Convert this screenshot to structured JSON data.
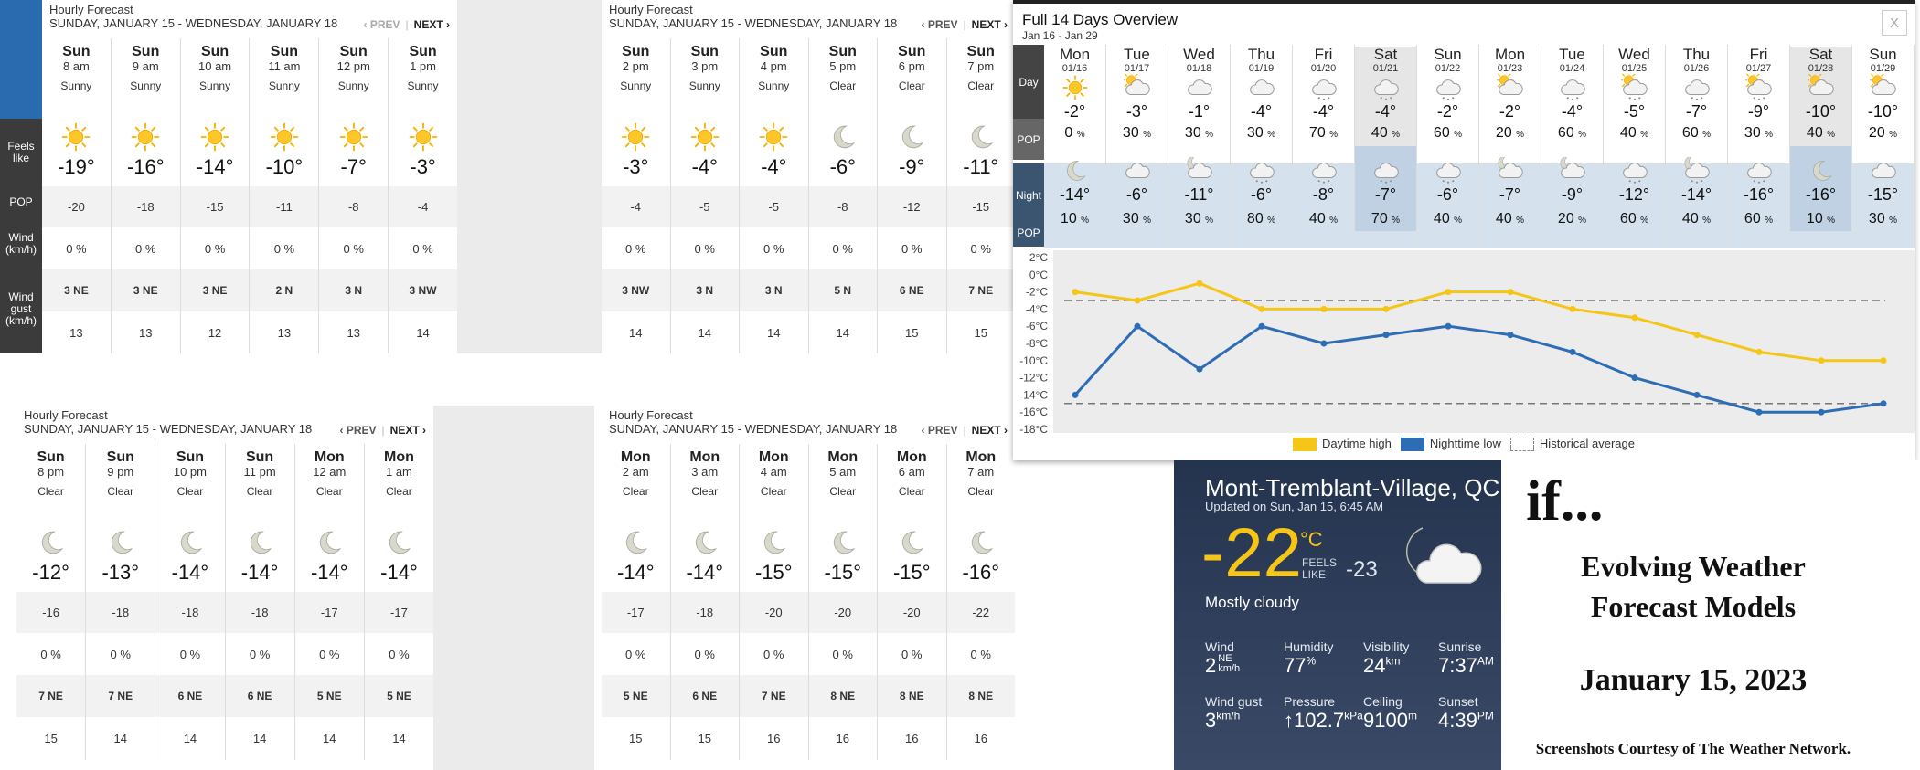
{
  "hourly_panels": [
    {
      "title": "Hourly Forecast",
      "range": "SUNDAY, JANUARY 15 - WEDNESDAY, JANUARY 18",
      "prev": "‹ PREV",
      "next": "NEXT ›",
      "hours": [
        {
          "day": "Sun",
          "hour": "8 am",
          "cond": "Sunny",
          "icon": "sun-icon",
          "temp": "-19°",
          "feels": "-20",
          "pop": "0 %",
          "wind": "3 NE",
          "gust": "13"
        },
        {
          "day": "Sun",
          "hour": "9 am",
          "cond": "Sunny",
          "icon": "sun-icon",
          "temp": "-16°",
          "feels": "-18",
          "pop": "0 %",
          "wind": "3 NE",
          "gust": "13"
        },
        {
          "day": "Sun",
          "hour": "10 am",
          "cond": "Sunny",
          "icon": "sun-icon",
          "temp": "-14°",
          "feels": "-15",
          "pop": "0 %",
          "wind": "3 NE",
          "gust": "12"
        },
        {
          "day": "Sun",
          "hour": "11 am",
          "cond": "Sunny",
          "icon": "sun-icon",
          "temp": "-10°",
          "feels": "-11",
          "pop": "0 %",
          "wind": "2 N",
          "gust": "13"
        },
        {
          "day": "Sun",
          "hour": "12 pm",
          "cond": "Sunny",
          "icon": "sun-icon",
          "temp": "-7°",
          "feels": "-8",
          "pop": "0 %",
          "wind": "3 N",
          "gust": "13"
        },
        {
          "day": "Sun",
          "hour": "1 pm",
          "cond": "Sunny",
          "icon": "sun-icon",
          "temp": "-3°",
          "feels": "-4",
          "pop": "0 %",
          "wind": "3 NW",
          "gust": "14"
        }
      ]
    },
    {
      "title": "Hourly Forecast",
      "range": "SUNDAY, JANUARY 15 - WEDNESDAY, JANUARY 18",
      "prev": "‹ PREV",
      "next": "NEXT ›",
      "hours": [
        {
          "day": "Sun",
          "hour": "2 pm",
          "cond": "Sunny",
          "icon": "sun-icon",
          "temp": "-3°",
          "feels": "-4",
          "pop": "0 %",
          "wind": "3 NW",
          "gust": "14"
        },
        {
          "day": "Sun",
          "hour": "3 pm",
          "cond": "Sunny",
          "icon": "sun-icon",
          "temp": "-4°",
          "feels": "-5",
          "pop": "0 %",
          "wind": "3 N",
          "gust": "14"
        },
        {
          "day": "Sun",
          "hour": "4 pm",
          "cond": "Sunny",
          "icon": "sun-icon",
          "temp": "-4°",
          "feels": "-5",
          "pop": "0 %",
          "wind": "3 N",
          "gust": "14"
        },
        {
          "day": "Sun",
          "hour": "5 pm",
          "cond": "Clear",
          "icon": "moon-icon",
          "temp": "-6°",
          "feels": "-8",
          "pop": "0 %",
          "wind": "5 N",
          "gust": "14"
        },
        {
          "day": "Sun",
          "hour": "6 pm",
          "cond": "Clear",
          "icon": "moon-icon",
          "temp": "-9°",
          "feels": "-12",
          "pop": "0 %",
          "wind": "6 NE",
          "gust": "15"
        },
        {
          "day": "Sun",
          "hour": "7 pm",
          "cond": "Clear",
          "icon": "moon-icon",
          "temp": "-11°",
          "feels": "-15",
          "pop": "0 %",
          "wind": "7 NE",
          "gust": "15"
        }
      ]
    },
    {
      "title": "Hourly Forecast",
      "range": "SUNDAY, JANUARY 15 - WEDNESDAY, JANUARY 18",
      "prev": "‹ PREV",
      "next": "NEXT ›",
      "hours": [
        {
          "day": "Sun",
          "hour": "8 pm",
          "cond": "Clear",
          "icon": "moon-icon",
          "temp": "-12°",
          "feels": "-16",
          "pop": "0 %",
          "wind": "7 NE",
          "gust": "15"
        },
        {
          "day": "Sun",
          "hour": "9 pm",
          "cond": "Clear",
          "icon": "moon-icon",
          "temp": "-13°",
          "feels": "-18",
          "pop": "0 %",
          "wind": "7 NE",
          "gust": "14"
        },
        {
          "day": "Sun",
          "hour": "10 pm",
          "cond": "Clear",
          "icon": "moon-icon",
          "temp": "-14°",
          "feels": "-18",
          "pop": "0 %",
          "wind": "6 NE",
          "gust": "14"
        },
        {
          "day": "Sun",
          "hour": "11 pm",
          "cond": "Clear",
          "icon": "moon-icon",
          "temp": "-14°",
          "feels": "-18",
          "pop": "0 %",
          "wind": "6 NE",
          "gust": "14"
        },
        {
          "day": "Mon",
          "hour": "12 am",
          "cond": "Clear",
          "icon": "moon-icon",
          "temp": "-14°",
          "feels": "-17",
          "pop": "0 %",
          "wind": "5 NE",
          "gust": "14"
        },
        {
          "day": "Mon",
          "hour": "1 am",
          "cond": "Clear",
          "icon": "moon-icon",
          "temp": "-14°",
          "feels": "-17",
          "pop": "0 %",
          "wind": "5 NE",
          "gust": "14"
        }
      ]
    },
    {
      "title": "Hourly Forecast",
      "range": "SUNDAY, JANUARY 15 - WEDNESDAY, JANUARY 18",
      "prev": "‹ PREV",
      "next": "NEXT ›",
      "hours": [
        {
          "day": "Mon",
          "hour": "2 am",
          "cond": "Clear",
          "icon": "moon-icon",
          "temp": "-14°",
          "feels": "-17",
          "pop": "0 %",
          "wind": "5 NE",
          "gust": "15"
        },
        {
          "day": "Mon",
          "hour": "3 am",
          "cond": "Clear",
          "icon": "moon-icon",
          "temp": "-14°",
          "feels": "-18",
          "pop": "0 %",
          "wind": "6 NE",
          "gust": "15"
        },
        {
          "day": "Mon",
          "hour": "4 am",
          "cond": "Clear",
          "icon": "moon-icon",
          "temp": "-15°",
          "feels": "-20",
          "pop": "0 %",
          "wind": "7 NE",
          "gust": "16"
        },
        {
          "day": "Mon",
          "hour": "5 am",
          "cond": "Clear",
          "icon": "moon-icon",
          "temp": "-15°",
          "feels": "-20",
          "pop": "0 %",
          "wind": "8 NE",
          "gust": "16"
        },
        {
          "day": "Mon",
          "hour": "6 am",
          "cond": "Clear",
          "icon": "moon-icon",
          "temp": "-15°",
          "feels": "-20",
          "pop": "0 %",
          "wind": "8 NE",
          "gust": "16"
        },
        {
          "day": "Mon",
          "hour": "7 am",
          "cond": "Clear",
          "icon": "moon-icon",
          "temp": "-16°",
          "feels": "-22",
          "pop": "0 %",
          "wind": "8 NE",
          "gust": "16"
        }
      ]
    }
  ],
  "row_labels": {
    "feels": "Feels like",
    "pop": "POP",
    "wind": "Wind (km/h)",
    "gust": "Wind gust (km/h)"
  },
  "overview": {
    "title": "Full 14 Days Overview",
    "range": "Jan 16 - Jan 29",
    "close": "X",
    "labels": {
      "day": "Day",
      "pop": "POP",
      "night": "Night",
      "pop2": "POP"
    },
    "days": [
      {
        "dow": "Mon",
        "date": "01/16",
        "day_icon": "sun-icon",
        "high": "-2°",
        "day_pop": "0",
        "night_icon": "moon-icon",
        "low": "-14°",
        "night_pop": "10"
      },
      {
        "dow": "Tue",
        "date": "01/17",
        "day_icon": "sun-cloud-icon",
        "high": "-3°",
        "day_pop": "30",
        "night_icon": "cloud-icon",
        "low": "-6°",
        "night_pop": "30"
      },
      {
        "dow": "Wed",
        "date": "01/18",
        "day_icon": "cloud-icon",
        "high": "-1°",
        "day_pop": "30",
        "night_icon": "moon-cloud-icon",
        "low": "-11°",
        "night_pop": "30"
      },
      {
        "dow": "Thu",
        "date": "01/19",
        "day_icon": "cloud-icon",
        "high": "-4°",
        "day_pop": "30",
        "night_icon": "snow-cloud-icon",
        "low": "-6°",
        "night_pop": "80"
      },
      {
        "dow": "Fri",
        "date": "01/20",
        "day_icon": "snow-cloud-icon",
        "high": "-4°",
        "day_pop": "70",
        "night_icon": "snow-cloud-icon",
        "low": "-8°",
        "night_pop": "40"
      },
      {
        "dow": "Sat",
        "date": "01/21",
        "day_icon": "snow-cloud-icon",
        "high": "-4°",
        "day_pop": "40",
        "night_icon": "snow-cloud-icon",
        "low": "-7°",
        "night_pop": "70"
      },
      {
        "dow": "Sun",
        "date": "01/22",
        "day_icon": "snow-cloud-icon",
        "high": "-2°",
        "day_pop": "60",
        "night_icon": "snow-cloud-icon",
        "low": "-6°",
        "night_pop": "40"
      },
      {
        "dow": "Mon",
        "date": "01/23",
        "day_icon": "sun-cloud-icon",
        "high": "-2°",
        "day_pop": "20",
        "night_icon": "moon-cloud-icon",
        "low": "-7°",
        "night_pop": "40"
      },
      {
        "dow": "Tue",
        "date": "01/24",
        "day_icon": "snow-cloud-icon",
        "high": "-4°",
        "day_pop": "60",
        "night_icon": "moon-cloud-icon",
        "low": "-9°",
        "night_pop": "20"
      },
      {
        "dow": "Wed",
        "date": "01/25",
        "day_icon": "sun-snow-icon",
        "high": "-5°",
        "day_pop": "40",
        "night_icon": "snow-cloud-icon",
        "low": "-12°",
        "night_pop": "60"
      },
      {
        "dow": "Thu",
        "date": "01/26",
        "day_icon": "snow-cloud-icon",
        "high": "-7°",
        "day_pop": "60",
        "night_icon": "moon-snow-icon",
        "low": "-14°",
        "night_pop": "40"
      },
      {
        "dow": "Fri",
        "date": "01/27",
        "day_icon": "sun-snow-icon",
        "high": "-9°",
        "day_pop": "30",
        "night_icon": "snow-cloud-icon",
        "low": "-16°",
        "night_pop": "60"
      },
      {
        "dow": "Sat",
        "date": "01/28",
        "day_icon": "sun-cloud-icon",
        "high": "-10°",
        "day_pop": "40",
        "night_icon": "moon-icon",
        "low": "-16°",
        "night_pop": "10"
      },
      {
        "dow": "Sun",
        "date": "01/29",
        "day_icon": "sun-cloud-icon",
        "high": "-10°",
        "day_pop": "20",
        "night_icon": "cloud-icon",
        "low": "-15°",
        "night_pop": "30"
      }
    ],
    "pop_unit": "%"
  },
  "chart_data": {
    "type": "line",
    "categories": [
      "01/16",
      "01/17",
      "01/18",
      "01/19",
      "01/20",
      "01/21",
      "01/22",
      "01/23",
      "01/24",
      "01/25",
      "01/26",
      "01/27",
      "01/28",
      "01/29"
    ],
    "series": [
      {
        "name": "Daytime high",
        "color": "#f5c518",
        "values": [
          -2,
          -3,
          -1,
          -4,
          -4,
          -4,
          -2,
          -2,
          -4,
          -5,
          -7,
          -9,
          -10,
          -10
        ]
      },
      {
        "name": "Nighttime low",
        "color": "#2d6db5",
        "values": [
          -14,
          -6,
          -11,
          -6,
          -8,
          -7,
          -6,
          -7,
          -9,
          -12,
          -14,
          -16,
          -16,
          -15
        ]
      }
    ],
    "historical_average": {
      "name": "Historical average",
      "high": -3,
      "low": -15
    },
    "yticks": [
      "2°C",
      "0°C",
      "-2°C",
      "-4°C",
      "-6°C",
      "-8°C",
      "-10°C",
      "-12°C",
      "-14°C",
      "-16°C",
      "-18°C"
    ],
    "ylim": [
      -18,
      2
    ],
    "legend_position": "bottom"
  },
  "current": {
    "city": "Mont-Tremblant-Village, QC",
    "updated": "Updated on Sun, Jan 15, 6:45 AM",
    "temp": "-22",
    "unit": "°C",
    "feels_label_1": "FEELS",
    "feels_label_2": "LIKE",
    "feels_value": "-23",
    "condition": "Mostly cloudy",
    "icon": "moon-cloud-icon",
    "stats": {
      "wind_label": "Wind",
      "wind_value": "2",
      "wind_dir": "NE",
      "wind_unit": "km/h",
      "humidity_label": "Humidity",
      "humidity_value": "77",
      "humidity_unit": "%",
      "visibility_label": "Visibility",
      "visibility_value": "24",
      "visibility_unit": "km",
      "sunrise_label": "Sunrise",
      "sunrise_value": "7:37",
      "sunrise_unit": "AM",
      "gust_label": "Wind gust",
      "gust_value": "3",
      "gust_unit": "km/h",
      "pressure_label": "Pressure",
      "pressure_value": "↑102.7",
      "pressure_unit": "kPa",
      "ceiling_label": "Ceiling",
      "ceiling_value": "9100",
      "ceiling_unit": "m",
      "sunset_label": "Sunset",
      "sunset_value": "4:39",
      "sunset_unit": "PM"
    }
  },
  "caption": {
    "if": "if...",
    "line1": "Evolving Weather",
    "line2": "Forecast Models",
    "date": "January 15, 2023",
    "credit": "Screenshots Courtesy of The Weather Network."
  }
}
